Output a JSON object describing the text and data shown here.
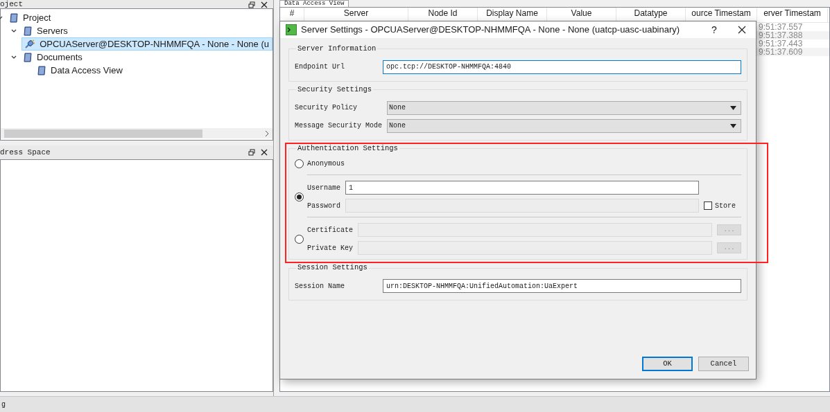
{
  "project_panel": {
    "title": "oject",
    "tree": [
      {
        "label": "Project",
        "selected": false,
        "expanded": true,
        "children": [
          {
            "label": "Servers",
            "selected": false,
            "expanded": true,
            "children": [
              {
                "label": "OPCUAServer@DESKTOP-NHMMFQA - None - None (u",
                "selected": true,
                "kind": "server"
              }
            ]
          },
          {
            "label": "Documents",
            "selected": false,
            "expanded": true,
            "children": [
              {
                "label": "Data Access View",
                "selected": false,
                "kind": "folder"
              }
            ]
          }
        ]
      }
    ]
  },
  "address_space_panel": {
    "title": "dress Space"
  },
  "document_tab": {
    "label": "Data Access View"
  },
  "table": {
    "columns": [
      "#",
      "Server",
      "Node Id",
      "Display Name",
      "Value",
      "Datatype",
      "ource Timestam",
      "erver Timestam"
    ],
    "rows": [
      {
        "timestamp": "9:51:37.557"
      },
      {
        "timestamp": "9:51:37.388"
      },
      {
        "timestamp": "9:51:37.443"
      },
      {
        "timestamp": "9:51:37.609"
      }
    ]
  },
  "dialog": {
    "title": "Server Settings - OPCUAServer@DESKTOP-NHMMFQA - None - None (uatcp-uasc-uabinary)",
    "help": "?",
    "server_information": {
      "title": "Server Information",
      "endpoint_url": {
        "label": "Endpoint Url",
        "value": "opc.tcp://DESKTOP-NHMMFQA:4840"
      }
    },
    "security_settings": {
      "title": "Security Settings",
      "fields": [
        {
          "label": "Security Policy",
          "value": "None"
        },
        {
          "label": "Message Security Mode",
          "value": "None"
        }
      ]
    },
    "authentication_settings": {
      "title": "Authentication Settings",
      "highlighted": true,
      "options": [
        {
          "kind": "anonymous",
          "selected": false,
          "label": "Anonymous"
        },
        {
          "kind": "user",
          "selected": true,
          "fields": [
            {
              "label": "Username",
              "value": "1",
              "disabled": false
            },
            {
              "label": "Password",
              "disabled": true
            }
          ],
          "store": {
            "label": "Store",
            "checked": false
          }
        },
        {
          "kind": "certificate",
          "selected": false,
          "fields": [
            {
              "label": "Certificate",
              "disabled": true,
              "browse": "..."
            },
            {
              "label": "Private Key",
              "disabled": true,
              "browse": "..."
            }
          ]
        }
      ]
    },
    "session_settings": {
      "title": "Session Settings",
      "session_name": {
        "label": "Session Name",
        "value": "urn:DESKTOP-NHMMFQA:UnifiedAutomation:UaExpert"
      }
    },
    "buttons": [
      {
        "label": "OK",
        "default": true
      },
      {
        "label": "Cancel",
        "default": false
      }
    ]
  },
  "status_bar": {
    "text": "g"
  }
}
